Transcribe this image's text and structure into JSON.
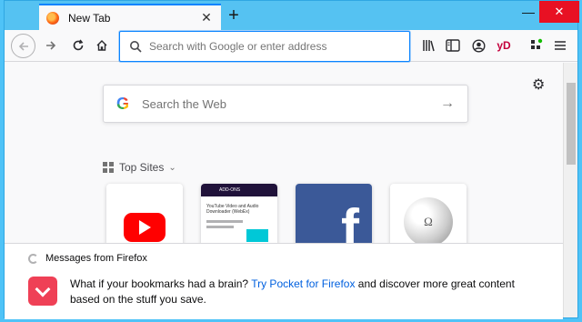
{
  "tab": {
    "title": "New Tab",
    "close": "✕"
  },
  "new_tab_label": "+",
  "window_controls": {
    "minimize": "—",
    "close": "✕"
  },
  "address_bar": {
    "placeholder": "Search with Google or enter address"
  },
  "toolbar_icons": [
    "library-icon",
    "sidebar-icon",
    "account-icon",
    "yd-extension-icon",
    "extensions-icon",
    "menu-icon"
  ],
  "extension_label": "yD",
  "search": {
    "placeholder": "Search the Web",
    "logo": "G"
  },
  "top_sites": {
    "header": "Top Sites",
    "tiles": [
      "youtube",
      "addon",
      "facebook",
      "wikipedia"
    ],
    "addon_header": "ADD-ONS",
    "addon_title": "YouTube Video and Audio Downloader (WebEx)",
    "facebook_letter": "f",
    "wiki_glyph": "Ω"
  },
  "messages": {
    "header": "Messages from Firefox",
    "text_before": "What if your bookmarks had a brain? ",
    "link": "Try Pocket for Firefox",
    "text_after": " and discover more great content based on the stuff you save."
  },
  "colors": {
    "accent": "#0a84ff",
    "titlebar": "#55c2f2",
    "pocket": "#ef4056",
    "facebook": "#3b5998",
    "youtube": "#ff0000"
  }
}
